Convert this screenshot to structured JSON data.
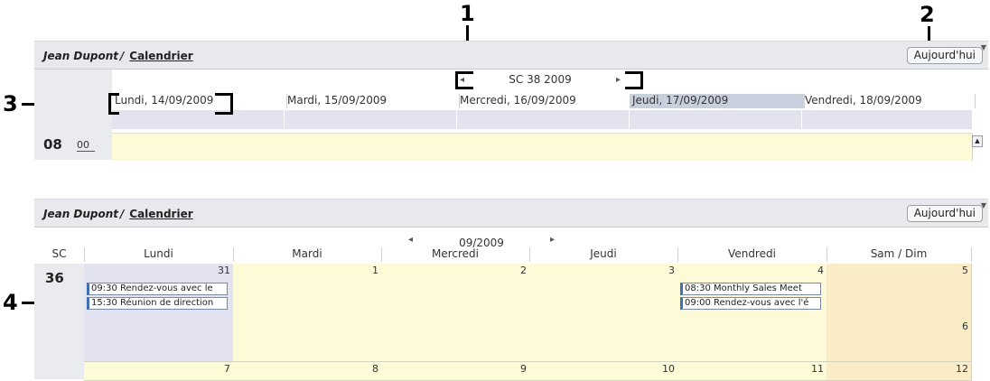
{
  "callouts": {
    "c1": "1",
    "c2": "2",
    "c3": "3",
    "c4": "4"
  },
  "week_view": {
    "owner": "Jean Dupont",
    "separator": "/",
    "calendar_link": "Calendrier",
    "today_button": "Aujourd'hui",
    "week_label": "SC 38 2009",
    "days": [
      "Lundi, 14/09/2009",
      "Mardi, 15/09/2009",
      "Mercredi, 16/09/2009",
      "Jeudi, 17/09/2009",
      "Vendredi, 18/09/2009"
    ],
    "highlighted_day_index": 3,
    "hour": "08",
    "minute": "00"
  },
  "month_view": {
    "owner": "Jean Dupont",
    "separator": "/",
    "calendar_link": "Calendrier",
    "today_button": "Aujourd'hui",
    "month_label": "09/2009",
    "week_col_header": "SC",
    "columns": [
      "Lundi",
      "Mardi",
      "Mercredi",
      "Jeudi",
      "Vendredi",
      "Sam / Dim"
    ],
    "week_number": "36",
    "row1_days": [
      "31",
      "1",
      "2",
      "3",
      "4",
      "5",
      "6"
    ],
    "row2_days": [
      "7",
      "8",
      "9",
      "10",
      "11",
      "12"
    ],
    "events": {
      "monday": [
        "09:30 Rendez-vous avec le",
        "15:30 Réunion de direction"
      ],
      "friday": [
        "08:30 Monthly Sales Meet",
        "09:00 Rendez-vous avec l'é"
      ]
    }
  },
  "colors": {
    "accent_event": "#3e6fb7",
    "slot_yellow": "#fdfad8",
    "weekend": "#fbecc8",
    "highlight_day": "#c9d0dd"
  }
}
